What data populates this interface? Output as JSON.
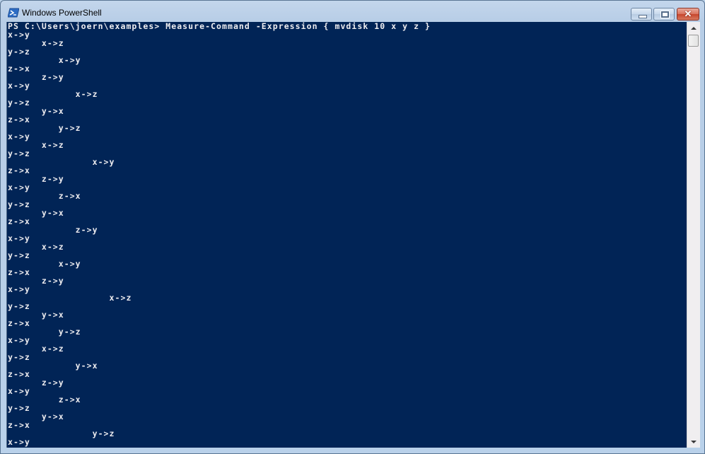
{
  "window": {
    "title": "Windows PowerShell",
    "icon": "powershell-icon",
    "controls": {
      "minimize": "minimize-icon",
      "maximize": "maximize-icon",
      "close": "close-icon",
      "close_glyph": "✕"
    }
  },
  "console": {
    "background": "#012456",
    "foreground": "#eeedf0",
    "lines": [
      "PS C:\\Users\\joern\\examples> Measure-Command -Expression { mvdisk 10 x y z }",
      "x->y",
      "      x->z",
      "y->z",
      "         x->y",
      "z->x",
      "      z->y",
      "x->y",
      "            x->z",
      "y->z",
      "      y->x",
      "z->x",
      "         y->z",
      "x->y",
      "      x->z",
      "y->z",
      "               x->y",
      "z->x",
      "      z->y",
      "x->y",
      "         z->x",
      "y->z",
      "      y->x",
      "z->x",
      "            z->y",
      "x->y",
      "      x->z",
      "y->z",
      "         x->y",
      "z->x",
      "      z->y",
      "x->y",
      "                  x->z",
      "y->z",
      "      y->x",
      "z->x",
      "         y->z",
      "x->y",
      "      x->z",
      "y->z",
      "            y->x",
      "z->x",
      "      z->y",
      "x->y",
      "         z->x",
      "y->z",
      "      y->x",
      "z->x",
      "               y->z",
      "x->y"
    ]
  },
  "scrollbar": {
    "up": "scroll-up-arrow-icon",
    "down": "scroll-down-arrow-icon"
  }
}
